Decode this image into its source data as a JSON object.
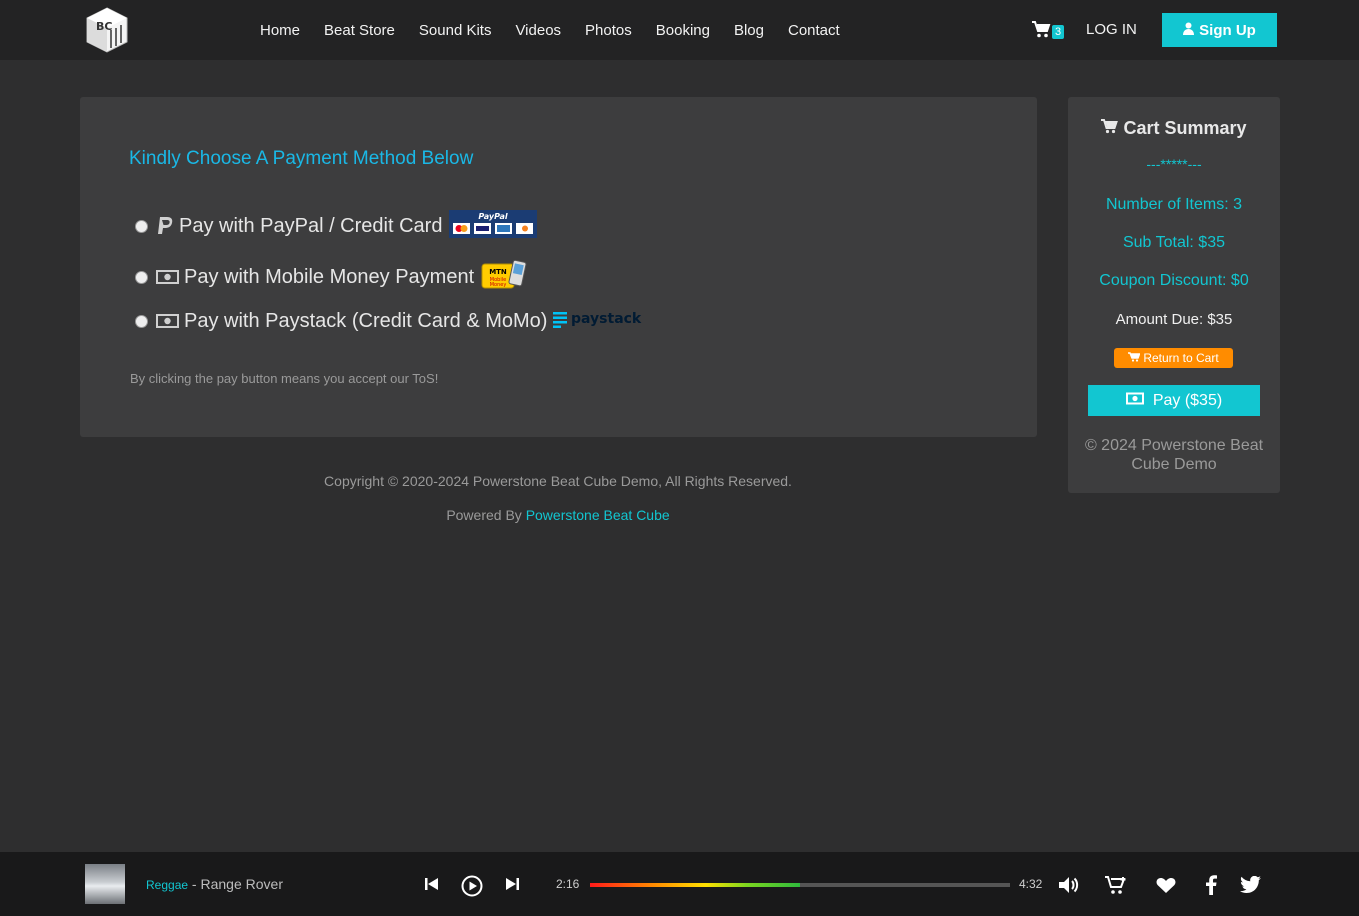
{
  "nav": {
    "logo_text": "BC",
    "links": [
      "Home",
      "Beat Store",
      "Sound Kits",
      "Videos",
      "Photos",
      "Booking",
      "Blog",
      "Contact"
    ],
    "cart_count": "3",
    "login_label": "LOG IN",
    "signup_label": "Sign Up"
  },
  "payment": {
    "title": "Kindly Choose A Payment Method Below",
    "options": [
      {
        "label": "Pay with PayPal / Credit Card",
        "badge_text": "PayPal"
      },
      {
        "label": "Pay with Mobile Money Payment",
        "badge_text": "MTN Mobile Money"
      },
      {
        "label": "Pay with Paystack (Credit Card & MoMo)",
        "badge_text": "paystack"
      }
    ],
    "tos": "By clicking the pay button means you accept our ToS!"
  },
  "footer": {
    "copyright": "Copyright © 2020-2024 Powerstone Beat Cube Demo, All Rights Reserved.",
    "powered_prefix": "Powered By ",
    "powered_link": "Powerstone Beat Cube"
  },
  "cart_summary": {
    "title": "Cart Summary",
    "divider": "---*****---",
    "items": "Number of Items: 3",
    "subtotal": "Sub Total: $35",
    "coupon": "Coupon Discount: $0",
    "amount_due": "Amount Due: $35",
    "return_label": "Return to Cart",
    "pay_label": "Pay ($35)",
    "copyright": "© 2024 Powerstone Beat Cube Demo"
  },
  "player": {
    "genre": "Reggae",
    "separator": " - ",
    "title": "Range Rover",
    "elapsed": "2:16",
    "duration": "4:32",
    "progress_fraction": 0.5
  },
  "colors": {
    "accent": "#12c6d1",
    "title_blue": "#1ab8e6",
    "orange": "#ff8c00",
    "panel": "#3d3d3e",
    "background": "#2e2e2f"
  }
}
